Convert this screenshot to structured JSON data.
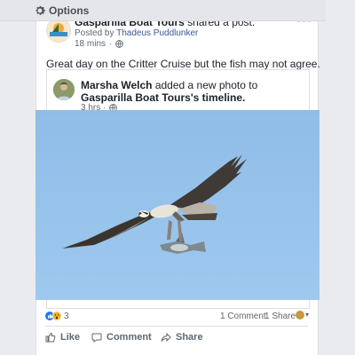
{
  "options_bar": {
    "label": "Options",
    "icon": "gear-icon"
  },
  "post": {
    "page_name": "Gasparilla Boat Tours",
    "action_text": "shared a post.",
    "posted_by_prefix": "Posted by",
    "posted_by_name": "Thadeus Puddlunker",
    "time": "18 mins",
    "text": "Great day on the Critter Cruise but the fish may not agree."
  },
  "shared": {
    "user_name": "Marsha Welch",
    "action_text": "added a new photo to",
    "target_name": "Gasparilla Boat Tours",
    "target_suffix": "'s timeline.",
    "time": "3 hrs"
  },
  "photo": {
    "subject": "osprey-carrying-fish"
  },
  "stats": {
    "reactions": "3",
    "comments": "1 Comment",
    "shares": "1 Share"
  },
  "actions": {
    "like": "Like",
    "comment": "Comment",
    "share": "Share"
  },
  "colors": {
    "link": "#385898",
    "text": "#1d2129",
    "secondary": "#606770",
    "sky": "#96c2ea",
    "like_blue": "#2078f4",
    "reaction_yellow": "#f7b125"
  }
}
